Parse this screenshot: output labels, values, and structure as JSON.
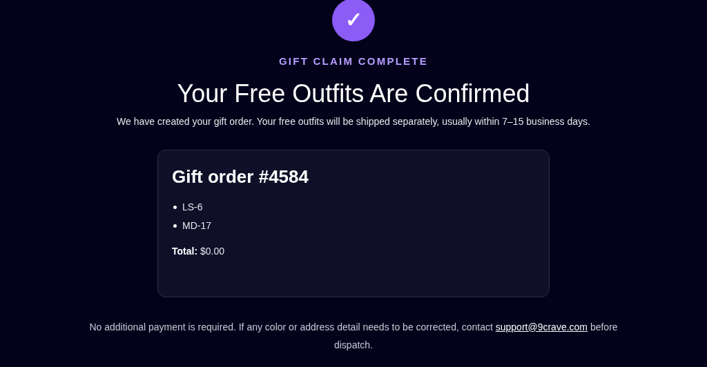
{
  "badge": {
    "symbol": "✓"
  },
  "eyebrow": "GIFT CLAIM COMPLETE",
  "title": "Your Free Outfits Are Confirmed",
  "subtitle": "We have created your gift order. Your free outfits will be shipped separately, usually within 7–15 business days.",
  "order": {
    "heading": "Gift order #4584",
    "items": [
      "LS-6",
      "MD-17"
    ],
    "total_label": "Total:",
    "total_value": "$0.00"
  },
  "footer": {
    "text_before": "No additional payment is required. If any color or address detail needs to be corrected, contact",
    "link": "support@9crave.com",
    "text_after": "before dispatch."
  }
}
